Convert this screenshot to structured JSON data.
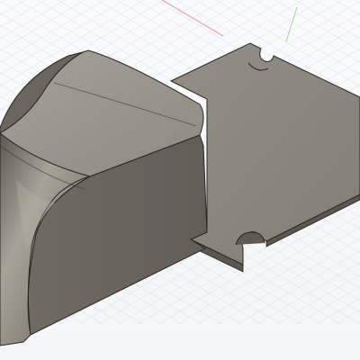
{
  "viewport": {
    "background": "#f5f7f9",
    "grid_color": "#e1e5ea",
    "axis_x_color": "#e88d8d",
    "axis_y_color": "#9fd79f"
  },
  "model": {
    "body_color": "#7f7a72",
    "top_color": "#9a958c",
    "side_color": "#6c675f",
    "edge_color": "#2a2723",
    "plate_color": "#8a857c"
  }
}
